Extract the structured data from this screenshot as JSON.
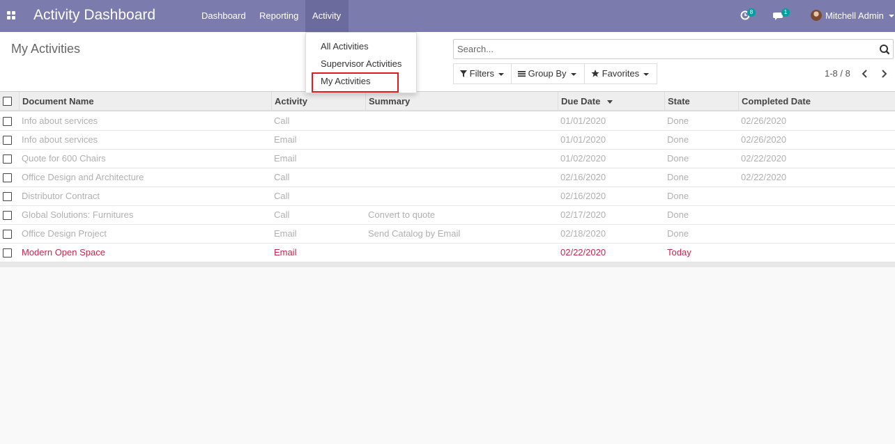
{
  "navbar": {
    "brand": "Activity Dashboard",
    "menu": [
      {
        "label": "Dashboard"
      },
      {
        "label": "Reporting"
      },
      {
        "label": "Activity"
      }
    ],
    "activity_badge": "8",
    "messages_badge": "1",
    "user_name": "Mitchell Admin",
    "colors": {
      "bar": "#7c7bad",
      "active": "#6b6b9d",
      "badge": "#00a09d"
    }
  },
  "activity_menu": {
    "items": [
      {
        "label": "All Activities"
      },
      {
        "label": "Supervisor Activities"
      },
      {
        "label": "My Activities"
      }
    ],
    "highlighted": "My Activities"
  },
  "control_panel": {
    "breadcrumb": "My Activities",
    "search_placeholder": "Search...",
    "filters_label": "Filters",
    "groupby_label": "Group By",
    "favorites_label": "Favorites",
    "pager": "1-8 / 8"
  },
  "table": {
    "columns": [
      "Document Name",
      "Activity",
      "Summary",
      "Due Date",
      "State",
      "Completed Date"
    ],
    "sorted_column": "Due Date",
    "rows": [
      {
        "document": "Info about services",
        "activity": "Call",
        "summary": "",
        "due": "01/01/2020",
        "state": "Done",
        "completed": "02/26/2020"
      },
      {
        "document": "Info about services",
        "activity": "Email",
        "summary": "",
        "due": "01/01/2020",
        "state": "Done",
        "completed": "02/26/2020"
      },
      {
        "document": "Quote for 600 Chairs",
        "activity": "Email",
        "summary": "",
        "due": "01/02/2020",
        "state": "Done",
        "completed": "02/22/2020"
      },
      {
        "document": "Office Design and Architecture",
        "activity": "Call",
        "summary": "",
        "due": "02/16/2020",
        "state": "Done",
        "completed": "02/22/2020"
      },
      {
        "document": "Distributor Contract",
        "activity": "Call",
        "summary": "",
        "due": "02/16/2020",
        "state": "Done",
        "completed": ""
      },
      {
        "document": "Global Solutions: Furnitures",
        "activity": "Call",
        "summary": "Convert to quote",
        "due": "02/17/2020",
        "state": "Done",
        "completed": ""
      },
      {
        "document": "Office Design Project",
        "activity": "Email",
        "summary": "Send Catalog by Email",
        "due": "02/18/2020",
        "state": "Done",
        "completed": ""
      },
      {
        "document": "Modern Open Space",
        "activity": "Email",
        "summary": "",
        "due": "02/22/2020",
        "state": "Today",
        "completed": ""
      }
    ],
    "colors": {
      "done": "#b0b0b0",
      "today": "#c4264b"
    }
  }
}
